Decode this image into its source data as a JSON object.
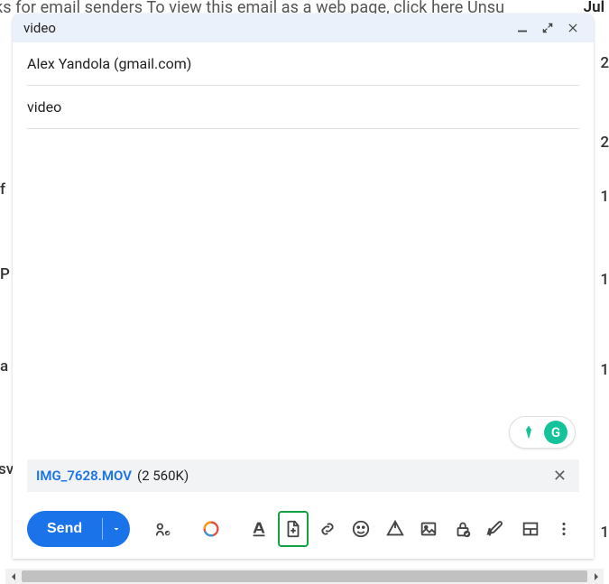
{
  "bg": {
    "snippet_text": "ks for email senders To view this email as a web page, click here Unsu",
    "date_partial": "Jul",
    "rows": [
      "2",
      "2",
      "1",
      "P",
      "1",
      "a",
      "1",
      "sv",
      "1"
    ]
  },
  "compose": {
    "title": "video",
    "recipient": "Alex Yandola (gmail.com)",
    "subject": "video",
    "attachment": {
      "name": "IMG_7628.MOV",
      "size": "(2 560K)"
    },
    "send_label": "Send"
  },
  "icons": {
    "minimize": "minimize",
    "expand": "expand",
    "close": "close",
    "signature": "signature",
    "colorpicker": "colorpicker",
    "textformat": "text-format",
    "attach": "attach",
    "link": "link",
    "emoji": "emoji",
    "drive": "drive",
    "image": "image",
    "lock": "confidential",
    "pen": "ink",
    "layout": "layout",
    "more": "more"
  }
}
